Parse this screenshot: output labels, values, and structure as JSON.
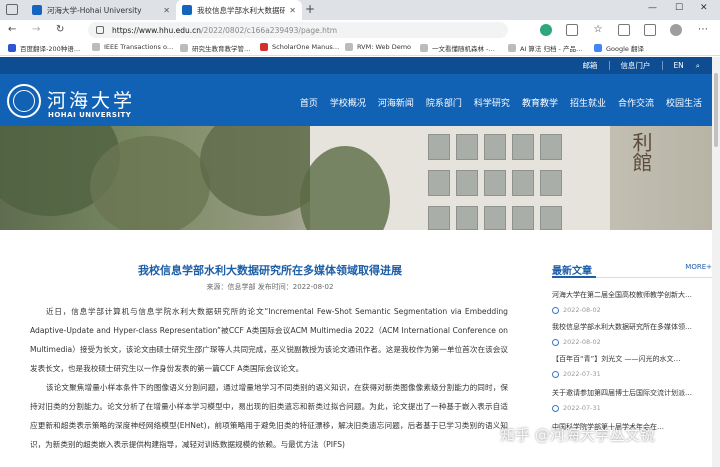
{
  "browser": {
    "tabs": [
      {
        "label": "河海大学-Hohai University"
      },
      {
        "label": "我校信息学部水利大数据研究所在"
      }
    ],
    "url": {
      "host": "https://www.hhu.edu.cn",
      "path": "/2022/0802/c166a239493/page.htm"
    },
    "bookmarks": [
      "百度翻译-200种语…",
      "IEEE Transactions o…",
      "研究生教育教学管…",
      "ScholarOne Manus…",
      "RVM: Web Demo",
      "一文看懂随机森林 -…",
      "AI 算法 归档 - 产品…",
      "Google 翻译"
    ]
  },
  "site": {
    "topbar": {
      "mail": "邮箱",
      "portal": "信息门户",
      "lang": "EN"
    },
    "logo": {
      "cn": "河海大学",
      "en": "HOHAI UNIVERSITY"
    },
    "nav": [
      "首页",
      "学校概况",
      "河海新闻",
      "院系部门",
      "科学研究",
      "教育教学",
      "招生就业",
      "合作交流",
      "校园生活"
    ],
    "banner_text": "利館"
  },
  "article": {
    "title": "我校信息学部水利大数据研究所在多媒体领域取得进展",
    "meta": "来源：信息学部   发布时间：2022-08-02",
    "paragraphs": [
      "近日，信息学部计算机与信息学院水利大数据研究所的论文“Incremental Few-Shot Semantic Segmentation via Embedding Adaptive-Update and Hyper-class Representation”被CCF A类国际会议ACM Multimedia 2022（ACM International Conference on Multimedia）接受为长文，该论文由硕士研究生邵广琛等人共同完成，巫义锐副教授为该论文通讯作者。这是我校作为第一单位首次在该会议发表长文，也是我校硕士研究生以一作身份发表的第一篇CCF A类国际会议论文。",
      "该论文聚焦增量小样本条件下的图像语义分割问题，通过增量地学习不同类别的语义知识，在获得对新类图像像素级分割能力的同时，保持对旧类的分割能力。论文分析了在增量小样本学习模型中，易出现的旧类遗忘和新类过拟合问题。为此，论文提出了一种基于嵌入表示自适应更新和超类表示策略的深度神经网络模型(EHNet)，前项策略用于避免旧类的特征漂移，解决旧类遗忘问题，后者基于已学习类别的语义知识，为新类别的超类嵌入表示提供构建指导，减轻对训练数据规模的依赖。与最优方法（PIFS)"
    ]
  },
  "sidebar": {
    "heading": "最新文章",
    "more": "MORE+",
    "items": [
      {
        "title": "河海大学在第二届全国高校教师教学创新大…",
        "date": "2022-08-02"
      },
      {
        "title": "我校信息学部水利大数据研究所在多媒体领…",
        "date": "2022-08-02"
      },
      {
        "title": "【百年百“青”】刘光文 ——闪光的水文…",
        "date": "2022-07-31"
      },
      {
        "title": "关于邀请参加第四届博士后国际交流计划派…",
        "date": "2022-07-31"
      },
      {
        "title": "中国科学院学部第十届学术年会在…",
        "date": ""
      }
    ]
  },
  "watermark": "知乎 @河海大学丛文锐"
}
